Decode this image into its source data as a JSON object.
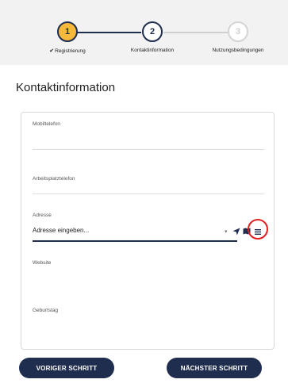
{
  "stepper": {
    "steps": [
      {
        "number": "1",
        "label": "Registrierung",
        "state": "done",
        "marker": "✔"
      },
      {
        "number": "2",
        "label": "Kontaktinformation",
        "state": "active"
      },
      {
        "number": "3",
        "label": "Nutzungsbedingungen",
        "state": "upcoming"
      }
    ]
  },
  "page": {
    "title": "Kontaktinformation"
  },
  "form": {
    "mobile_label": "Mobiltelefon",
    "workphone_label": "Arbeitsplatztelefon",
    "address_label": "Adresse",
    "address_placeholder": "Adresse eingeben...",
    "website_label": "Website",
    "birthday_label": "Geburtstag"
  },
  "buttons": {
    "previous": "VORIGER SCHRITT",
    "next": "NÄCHSTER SCHRITT"
  },
  "colors": {
    "primary": "#1f2d4f",
    "accent": "#f6b93b",
    "highlight": "#e02020"
  }
}
